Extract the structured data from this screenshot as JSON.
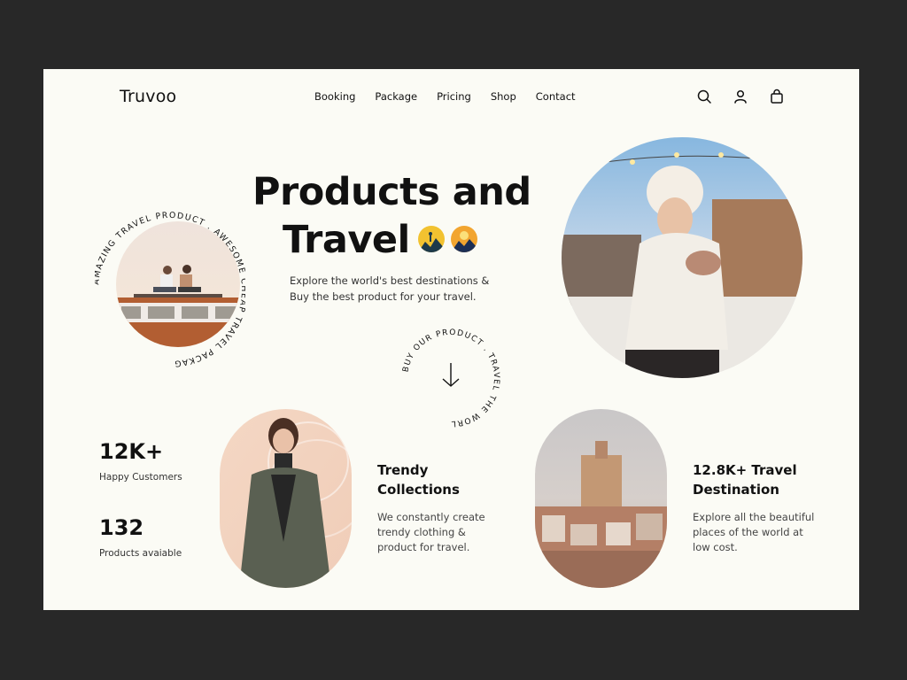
{
  "brand": {
    "name": "Truvoo"
  },
  "nav": {
    "items": [
      "Booking",
      "Package",
      "Pricing",
      "Shop",
      "Contact"
    ]
  },
  "header_icons": [
    "search-icon",
    "user-icon",
    "bag-icon"
  ],
  "hero": {
    "title_line1": "Products and",
    "title_line2": "Travel",
    "description_line1": "Explore the world's best destinations &",
    "description_line2": "Buy the best product for your travel.",
    "circular_text_left": "AMAZING TRAVEL PRODUCT . AWESOME CHEAP TRAVEL PACKAGE",
    "circular_text_center": "BUY OUR PRODUCT . TRAVEL THE WORLD ."
  },
  "stats": [
    {
      "value": "12K+",
      "label": "Happy Customers"
    },
    {
      "value": "132",
      "label": "Products avaiable"
    }
  ],
  "cards": [
    {
      "title_line1": "Trendy",
      "title_line2": "Collections",
      "text_lines": [
        "We constantly create",
        "trendy clothing &",
        "product for travel."
      ]
    },
    {
      "title_line1": "12.8K+ Travel",
      "title_line2": "Destination",
      "text_lines": [
        "Explore all the beautiful",
        "places of the world at",
        "low cost."
      ]
    }
  ],
  "colors": {
    "page_bg": "#282828",
    "panel_bg": "#fbfbf5",
    "text": "#111111"
  }
}
